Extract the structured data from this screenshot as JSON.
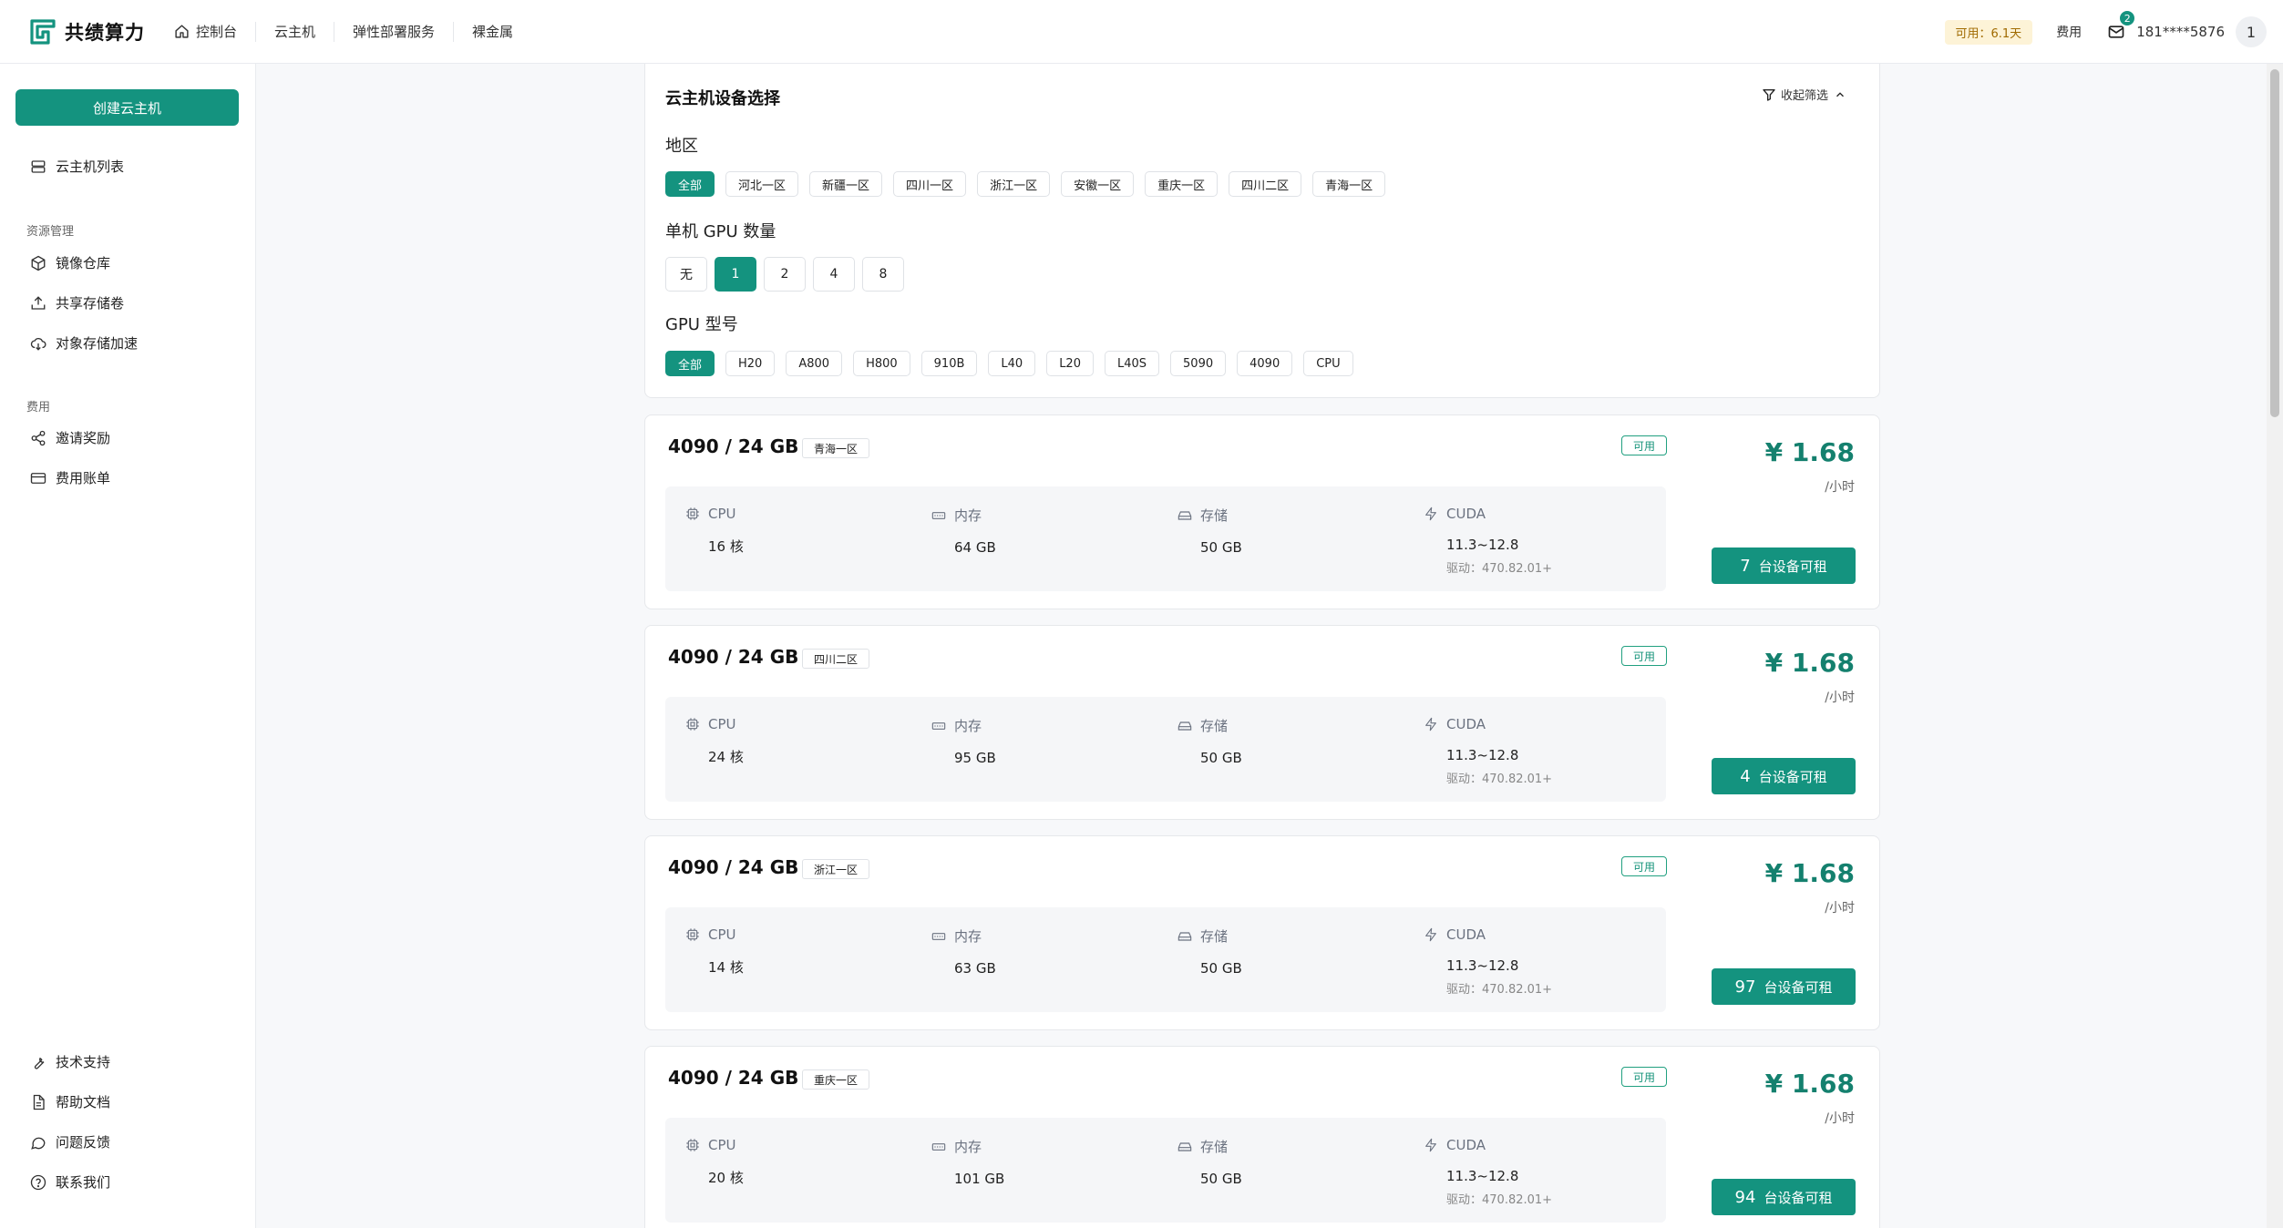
{
  "header": {
    "logo_text": "共绩算力",
    "nav": [
      {
        "label": "控制台",
        "icon": "home-icon"
      },
      {
        "label": "云主机"
      },
      {
        "label": "弹性部署服务"
      },
      {
        "label": "裸金属"
      }
    ],
    "available_label": "可用：6.1天",
    "fee_label": "费用",
    "mail_count": "2",
    "user_phone": "181****5876",
    "avatar_text": "1"
  },
  "sidebar": {
    "create_button": "创建云主机",
    "items": [
      {
        "label": "云主机列表",
        "icon": "server-list-icon"
      },
      {
        "label": "镜像仓库",
        "icon": "cube-icon"
      },
      {
        "label": "共享存储卷",
        "icon": "upload-storage-icon"
      },
      {
        "label": "对象存储加速",
        "icon": "cloud-sync-icon"
      },
      {
        "label": "邀请奖励",
        "icon": "share-icon"
      },
      {
        "label": "费用账单",
        "icon": "card-icon"
      },
      {
        "label": "技术支持",
        "icon": "wrench-icon"
      },
      {
        "label": "帮助文档",
        "icon": "document-icon"
      },
      {
        "label": "问题反馈",
        "icon": "chat-bubble-icon"
      },
      {
        "label": "联系我们",
        "icon": "help-circle-icon"
      }
    ],
    "groups": [
      "资源管理",
      "费用"
    ]
  },
  "filter": {
    "title": "云主机设备选择",
    "collapse_label": "收起筛选",
    "region_label": "地区",
    "regions": [
      "全部",
      "河北一区",
      "新疆一区",
      "四川一区",
      "浙江一区",
      "安徽一区",
      "重庆一区",
      "四川二区",
      "青海一区"
    ],
    "region_selected": "全部",
    "gpu_count_label": "单机 GPU 数量",
    "gpu_counts": [
      "无",
      "1",
      "2",
      "4",
      "8"
    ],
    "gpu_count_selected": "1",
    "gpu_model_label": "GPU 型号",
    "gpu_models": [
      "全部",
      "H20",
      "A800",
      "H800",
      "910B",
      "L40",
      "L20",
      "L40S",
      "5090",
      "4090",
      "CPU"
    ],
    "gpu_model_selected": "全部"
  },
  "spec_labels": {
    "cpu": "CPU",
    "memory": "内存",
    "storage": "存储",
    "cuda": "CUDA"
  },
  "cards": [
    {
      "title": "4090 / 24 GB",
      "region": "青海一区",
      "status": "可用",
      "cpu": "16 核",
      "memory": "64 GB",
      "storage": "50 GB",
      "cuda": "11.3~12.8",
      "driver": "驱动：470.82.01+",
      "price": "¥ 1.68",
      "unit": "/小时",
      "count": "7",
      "rent_label": "台设备可租"
    },
    {
      "title": "4090 / 24 GB",
      "region": "四川二区",
      "status": "可用",
      "cpu": "24 核",
      "memory": "95 GB",
      "storage": "50 GB",
      "cuda": "11.3~12.8",
      "driver": "驱动：470.82.01+",
      "price": "¥ 1.68",
      "unit": "/小时",
      "count": "4",
      "rent_label": "台设备可租"
    },
    {
      "title": "4090 / 24 GB",
      "region": "浙江一区",
      "status": "可用",
      "cpu": "14 核",
      "memory": "63 GB",
      "storage": "50 GB",
      "cuda": "11.3~12.8",
      "driver": "驱动：470.82.01+",
      "price": "¥ 1.68",
      "unit": "/小时",
      "count": "97",
      "rent_label": "台设备可租"
    },
    {
      "title": "4090 / 24 GB",
      "region": "重庆一区",
      "status": "可用",
      "cpu": "20 核",
      "memory": "101 GB",
      "storage": "50 GB",
      "cuda": "11.3~12.8",
      "driver": "驱动：470.82.01+",
      "price": "¥ 1.68",
      "unit": "/小时",
      "count": "94",
      "rent_label": "台设备可租"
    }
  ],
  "colors": {
    "accent": "#14937f",
    "price": "#14806e",
    "badge_bg": "#fdf3d7"
  }
}
